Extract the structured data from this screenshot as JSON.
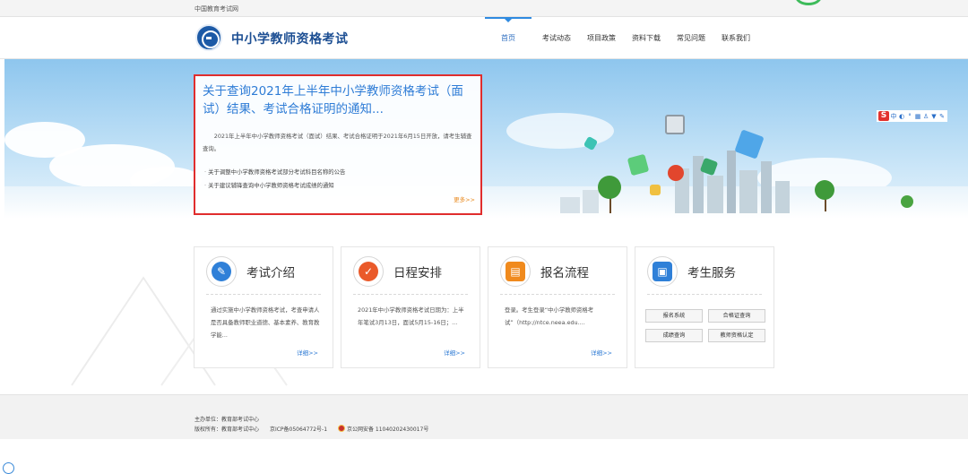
{
  "topbar": {
    "site_name": "中国教育考试网"
  },
  "header": {
    "brand": "中小学教师资格考试",
    "nav": [
      "首页",
      "考试动态",
      "项目政策",
      "资料下载",
      "常见问题",
      "联系我们"
    ]
  },
  "notice": {
    "title": "关于查询2021年上半年中小学教师资格考试（面试）结果、考试合格证明的通知...",
    "summary": "2021年上半年中小学教师资格考试（面试）结果、考试合格证明于2021年6月15日开放，请考生辅查查询。",
    "links": [
      "关于调整中小学教师资格考试部分考试科目名称的公告",
      "关于建议辅锋查询中小学教师资格考试成绩的通知"
    ],
    "more": "更多>>"
  },
  "toolbar": {
    "s_label": "S",
    "ime_label": "中"
  },
  "cards": [
    {
      "title": "考试介绍",
      "icon": "edit-icon",
      "color": "#2f80d8",
      "desc": "通过实施中小学教师资格考试，考查申请人是否具备教师职业道德、基本素养、教育教学能...",
      "more": "详细>>"
    },
    {
      "title": "日程安排",
      "icon": "check-icon",
      "color": "#ea5a2a",
      "desc": "2021年中小学教师资格考试日期为：上半年笔试3月13日，面试5月15-16日；...",
      "more": "详细>>"
    },
    {
      "title": "报名流程",
      "icon": "form-icon",
      "color": "#f08a1d",
      "desc": "登录。考生登录“中小学教师资格考试”（http://ntce.neea.edu....",
      "more": "详细>>"
    },
    {
      "title": "考生服务",
      "icon": "id-card-icon",
      "color": "#2f80d8",
      "services": [
        "报名系统",
        "合格证查询",
        "成绩查询",
        "教师资格认定"
      ]
    }
  ],
  "footer": {
    "sponsor": "主办单位：教育部考试中心",
    "copyright": "版权所有：教育部考试中心",
    "icp": "京ICP备05064772号-1",
    "police": "京公网安备 11040202430017号"
  }
}
